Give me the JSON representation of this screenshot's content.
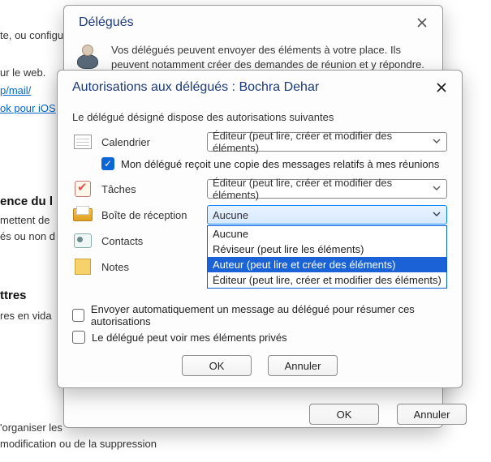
{
  "background": {
    "line1": "te, ou configu",
    "line2": "ur le web.",
    "link1": "p/mail/",
    "link2": "ok pour iOS",
    "heading1": "ence du l",
    "para1a": "mettent de",
    "para1b": "és ou non d",
    "heading2": "ttres",
    "para2": "res en vida",
    "footer1": "'organiser les",
    "footer2": "modification ou de la suppression"
  },
  "delegues": {
    "title": "Délégués",
    "text": "Vos délégués peuvent envoyer des éléments à votre place. Ils peuvent notamment créer des demandes de réunion et y répondre. Si vous"
  },
  "perm": {
    "title": "Autorisations aux délégués : Bochra Dehar",
    "desc": "Le délégué désigné dispose des autorisations suivantes",
    "calendar_label": "Calendrier",
    "calendar_value": "Éditeur (peut lire, créer et modifier des éléments)",
    "checkbox_copy": "Mon délégué reçoit une copie des messages relatifs à mes réunions",
    "tasks_label": "Tâches",
    "tasks_value": "Éditeur (peut lire, créer et modifier des éléments)",
    "inbox_label": "Boîte de réception",
    "inbox_value": "Aucune",
    "inbox_options": [
      "Aucune",
      "Réviseur (peut lire les éléments)",
      "Auteur (peut lire et créer des éléments)",
      "Éditeur (peut lire, créer et modifier des éléments)"
    ],
    "contacts_label": "Contacts",
    "notes_label": "Notes",
    "auto_send": "Envoyer automatiquement un message au délégué pour résumer ces autorisations",
    "private_items": "Le délégué peut voir mes éléments privés",
    "ok": "OK",
    "cancel": "Annuler"
  },
  "bottom": {
    "ok": "OK",
    "cancel": "Annuler"
  }
}
